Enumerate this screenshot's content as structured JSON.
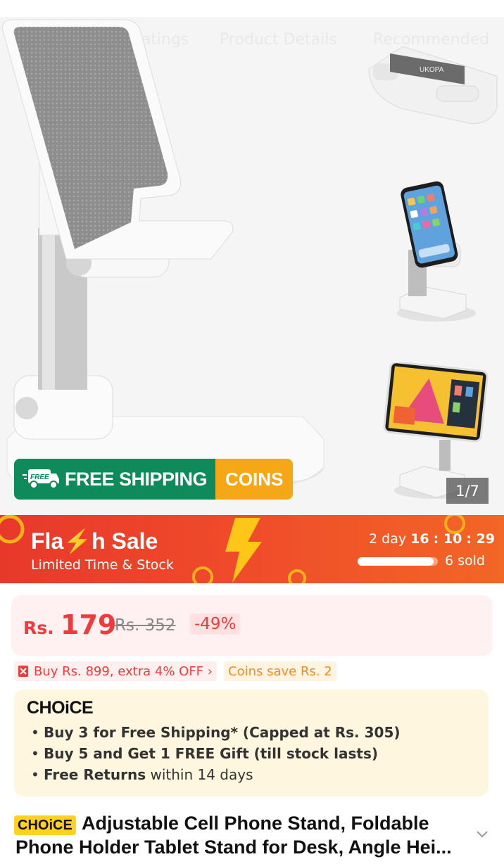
{
  "tabs": [
    "Ratings",
    "Product Details",
    "Recommended"
  ],
  "gallery": {
    "counter": "1/7",
    "thumbnail_brand": "UKOPA"
  },
  "shipping_banner": {
    "free_tag": "FREE",
    "label": "FREE SHIPPING",
    "coins_label": "COINS"
  },
  "flash_sale": {
    "title": "Fla⚡h  Sale",
    "subtitle": "Limited Time & Stock",
    "days": "2 day",
    "hours": "16",
    "minutes": "10",
    "seconds": "29",
    "sold": "6 sold",
    "sold_progress": 0.95
  },
  "price": {
    "currency": "Rs.",
    "current": "179",
    "original": "Rs. 352",
    "discount": "-49%"
  },
  "promos": {
    "bundle": "Buy Rs. 899, extra 4% OFF  ›",
    "coins": "Coins save Rs. 2"
  },
  "choice": {
    "logo": "CHOiCE",
    "bullets": [
      {
        "bold": "Buy 3 for  Free Shipping* (Capped at Rs. 305)",
        "rest": ""
      },
      {
        "bold": "Buy 5 and Get 1 FREE Gift (till stock lasts)",
        "rest": ""
      },
      {
        "bold": "Free Returns",
        "rest": " within 14 days"
      }
    ]
  },
  "product": {
    "badge": "CHOiCE",
    "title_line1": "Adjustable Cell Phone Stand, Foldable",
    "title_line2": "Phone Holder Tablet Stand for Desk, Angle Hei..."
  },
  "colors": {
    "green": "#0e8a5b",
    "orange": "#f5a716",
    "red": "#f23a3a",
    "choice_yellow": "#ffd21f"
  }
}
